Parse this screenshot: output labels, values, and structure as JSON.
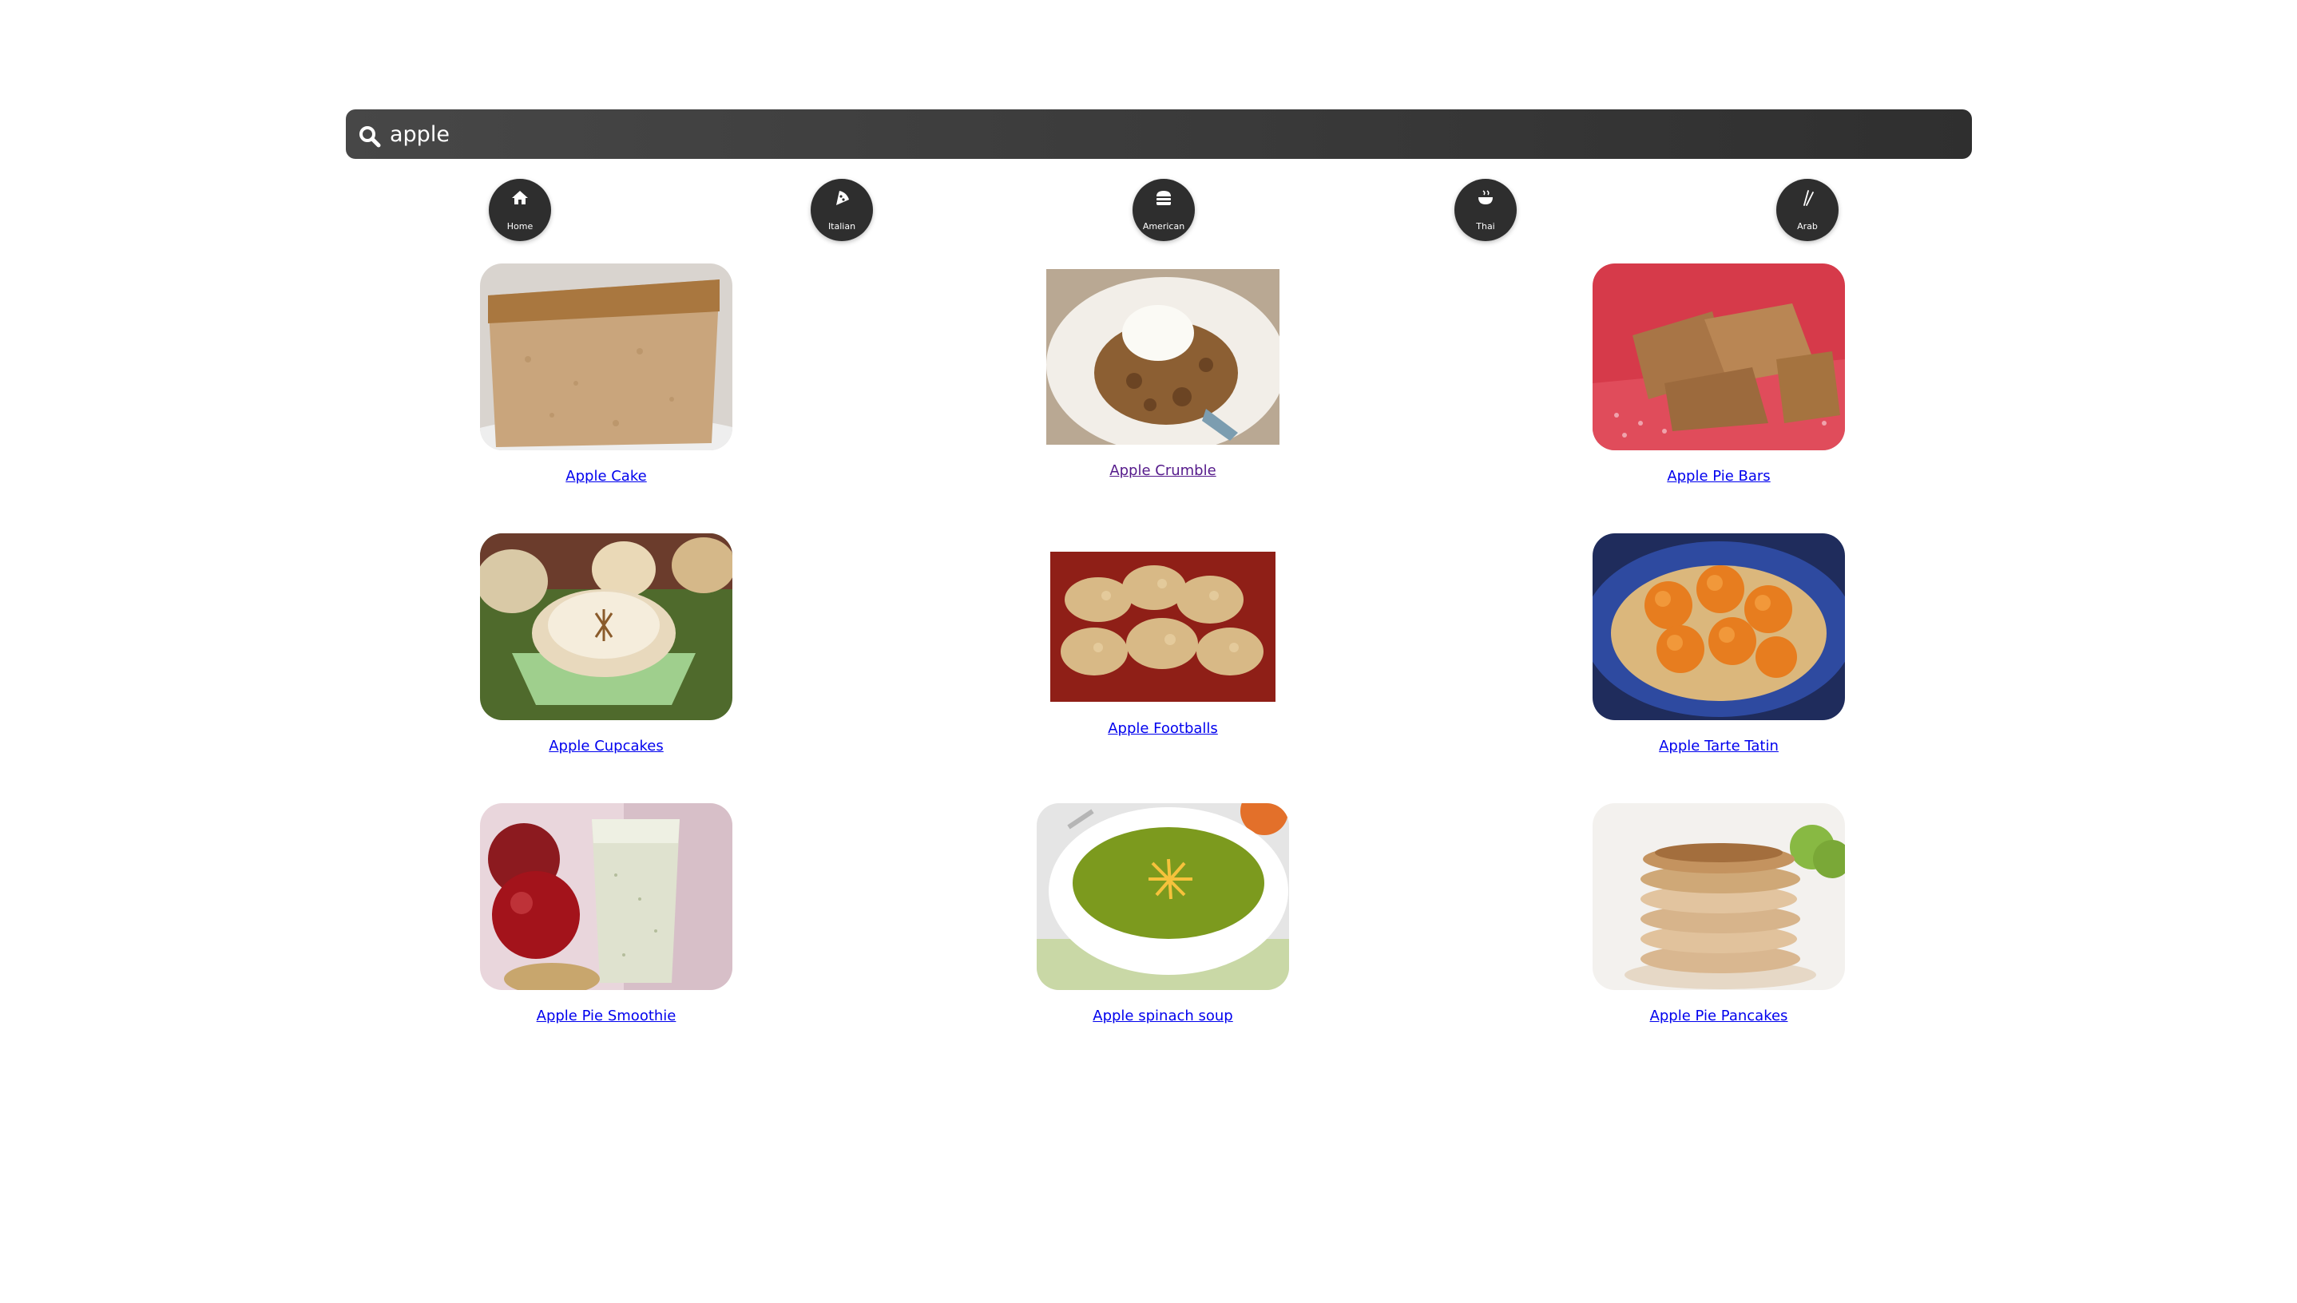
{
  "search": {
    "value": "apple"
  },
  "categories": [
    {
      "label": "Home",
      "icon": "home-icon"
    },
    {
      "label": "Italian",
      "icon": "pizza-icon"
    },
    {
      "label": "American",
      "icon": "burger-icon"
    },
    {
      "label": "Thai",
      "icon": "bowl-icon"
    },
    {
      "label": "Arab",
      "icon": "chopsticks-icon"
    }
  ],
  "recipes": [
    {
      "label": "Apple Cake",
      "image": "apple-cake-photo"
    },
    {
      "label": "Apple Crumble",
      "image": "apple-crumble-photo"
    },
    {
      "label": "Apple Pie Bars",
      "image": "apple-pie-bars-photo"
    },
    {
      "label": "Apple Cupcakes",
      "image": "apple-cupcakes-photo"
    },
    {
      "label": "Apple Footballs",
      "image": "apple-footballs-photo"
    },
    {
      "label": "Apple Tarte Tatin",
      "image": "apple-tarte-tatin-photo"
    },
    {
      "label": "Apple Pie Smoothie",
      "image": "apple-pie-smoothie-photo"
    },
    {
      "label": "Apple spinach soup",
      "image": "apple-spinach-soup-photo"
    },
    {
      "label": "Apple Pie Pancakes",
      "image": "apple-pie-pancakes-photo"
    }
  ],
  "colors": {
    "bar": "#3c3c3c",
    "category": "#2e2e2e",
    "link": "#0000ee",
    "visited_link": "#551a8b"
  }
}
